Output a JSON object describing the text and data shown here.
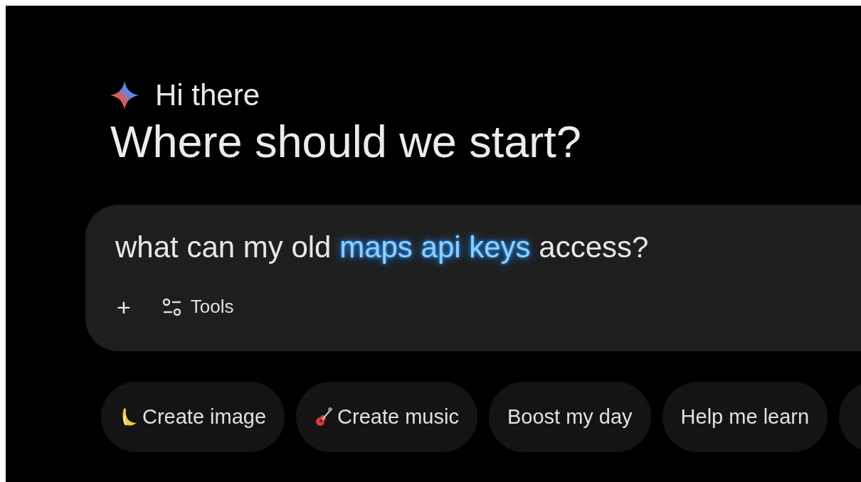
{
  "greeting": "Hi there",
  "heading": "Where should we start?",
  "prompt": {
    "segments": [
      {
        "text": "what can my old",
        "highlighted": false
      },
      {
        "text": "maps api keys",
        "highlighted": true
      },
      {
        "text": "access?",
        "highlighted": false
      }
    ]
  },
  "toolbar": {
    "add": "+",
    "tools": "Tools"
  },
  "chips": [
    {
      "label": "Create image",
      "kind": "banana"
    },
    {
      "label": "Create music",
      "kind": "guitar"
    },
    {
      "label": "Boost my day",
      "kind": "plain"
    },
    {
      "label": "Help me learn",
      "kind": "plain"
    }
  ]
}
